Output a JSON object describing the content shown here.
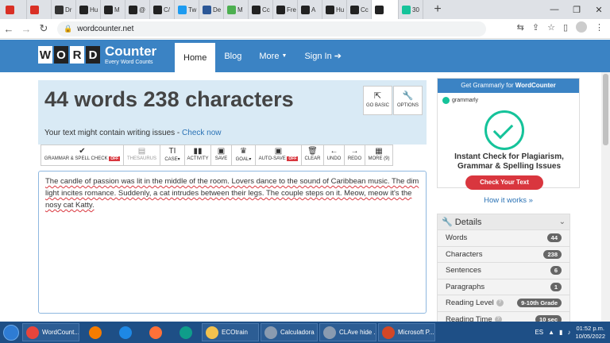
{
  "browser": {
    "tabs": [
      {
        "label": "",
        "icon": "notification-badge-icon",
        "color": "#d93025"
      },
      {
        "label": "",
        "icon": "record-icon",
        "color": "#d93025"
      },
      {
        "label": "Dr",
        "icon": "circle-icon",
        "color": "#333333"
      },
      {
        "label": "Hu",
        "icon": "a-logo-icon",
        "color": "#222222"
      },
      {
        "label": "M",
        "icon": "a-logo-icon",
        "color": "#222222"
      },
      {
        "label": "@",
        "icon": "a-logo-icon",
        "color": "#222222"
      },
      {
        "label": "C/",
        "icon": "a-logo-icon",
        "color": "#222222"
      },
      {
        "label": "Tw",
        "icon": "twitter-icon",
        "color": "#1d9bf0"
      },
      {
        "label": "De",
        "icon": "hex-icon",
        "color": "#2b5797"
      },
      {
        "label": "M",
        "icon": "px-icon",
        "color": "#4caf50"
      },
      {
        "label": "Cc",
        "icon": "a-logo-icon",
        "color": "#222222"
      },
      {
        "label": "Fre",
        "icon": "a-logo-icon",
        "color": "#222222"
      },
      {
        "label": "A",
        "icon": "a-logo-icon",
        "color": "#222222"
      },
      {
        "label": "Hu",
        "icon": "a-logo-icon",
        "color": "#222222"
      },
      {
        "label": "Cc",
        "icon": "a-logo-icon",
        "color": "#222222"
      },
      {
        "label": "",
        "icon": "w-logo-icon",
        "color": "#222222",
        "active": true
      },
      {
        "label": "30",
        "icon": "d-logo-icon",
        "color": "#15c39a"
      }
    ],
    "url": "wordcounter.net"
  },
  "site": {
    "logo_letters": [
      "W",
      "O",
      "R",
      "D"
    ],
    "logo_big": "Counter",
    "logo_small": "Every Word Counts",
    "nav": {
      "home": "Home",
      "blog": "Blog",
      "more": "More",
      "signin": "Sign In"
    }
  },
  "main": {
    "count_title": "44 words 238 characters",
    "issue_text": "Your text might contain writing issues - ",
    "issue_link": "Check now",
    "go_basic": "GO BASIC",
    "options": "OPTIONS",
    "toolbar": {
      "grammar": "GRAMMAR & SPELL CHECK",
      "off": "OFF",
      "thesaurus": "THESAURUS",
      "case": "CASE",
      "activity": "ACTIVITY",
      "save": "SAVE",
      "goal": "GOAL",
      "autosave": "AUTO-SAVE",
      "clear": "CLEAR",
      "undo": "UNDO",
      "redo": "REDO",
      "more": "MORE (9)"
    },
    "editor_text": "The candle of passion was lit in the middle of the room. Lovers dance to the sound of Caribbean music. The dim light incites romance. Suddenly, a cat intrudes between their legs. The couple steps on it. Meow, meow it's the nosy cat Katty."
  },
  "ad": {
    "head_prefix": "Get Grammarly for ",
    "head_brand": "WordCounter",
    "logo_text": "grammarly",
    "line1": "Instant Check for Plagiarism,",
    "line2": "Grammar & Spelling Issues",
    "button": "Check Your Text",
    "accent": "#15c39a"
  },
  "how_it_works": "How it works »",
  "details": {
    "title": "Details",
    "rows": [
      {
        "label": "Words",
        "value": "44"
      },
      {
        "label": "Characters",
        "value": "238"
      },
      {
        "label": "Sentences",
        "value": "6"
      },
      {
        "label": "Paragraphs",
        "value": "1"
      },
      {
        "label": "Reading Level",
        "value": "9-10th Grade"
      },
      {
        "label": "Reading Time",
        "value": "10 sec"
      }
    ]
  },
  "taskbar": {
    "items": [
      {
        "label": "WordCount...",
        "color": "#e8453c"
      },
      {
        "label": "",
        "color": "#f57c00"
      },
      {
        "label": "",
        "color": "#1e88e5"
      },
      {
        "label": "",
        "color": "#ff7139"
      },
      {
        "label": "",
        "color": "#0f9d8a"
      },
      {
        "label": "ECOtrain",
        "color": "#f2c14e"
      },
      {
        "label": "Calculadora",
        "color": "#8a9bb0"
      },
      {
        "label": "CLAve hide ...",
        "color": "#8a9bb0"
      },
      {
        "label": "Microsoft P...",
        "color": "#d24726"
      }
    ],
    "time": "01:52 p.m.",
    "date": "10/05/2022",
    "lang": "ES"
  }
}
